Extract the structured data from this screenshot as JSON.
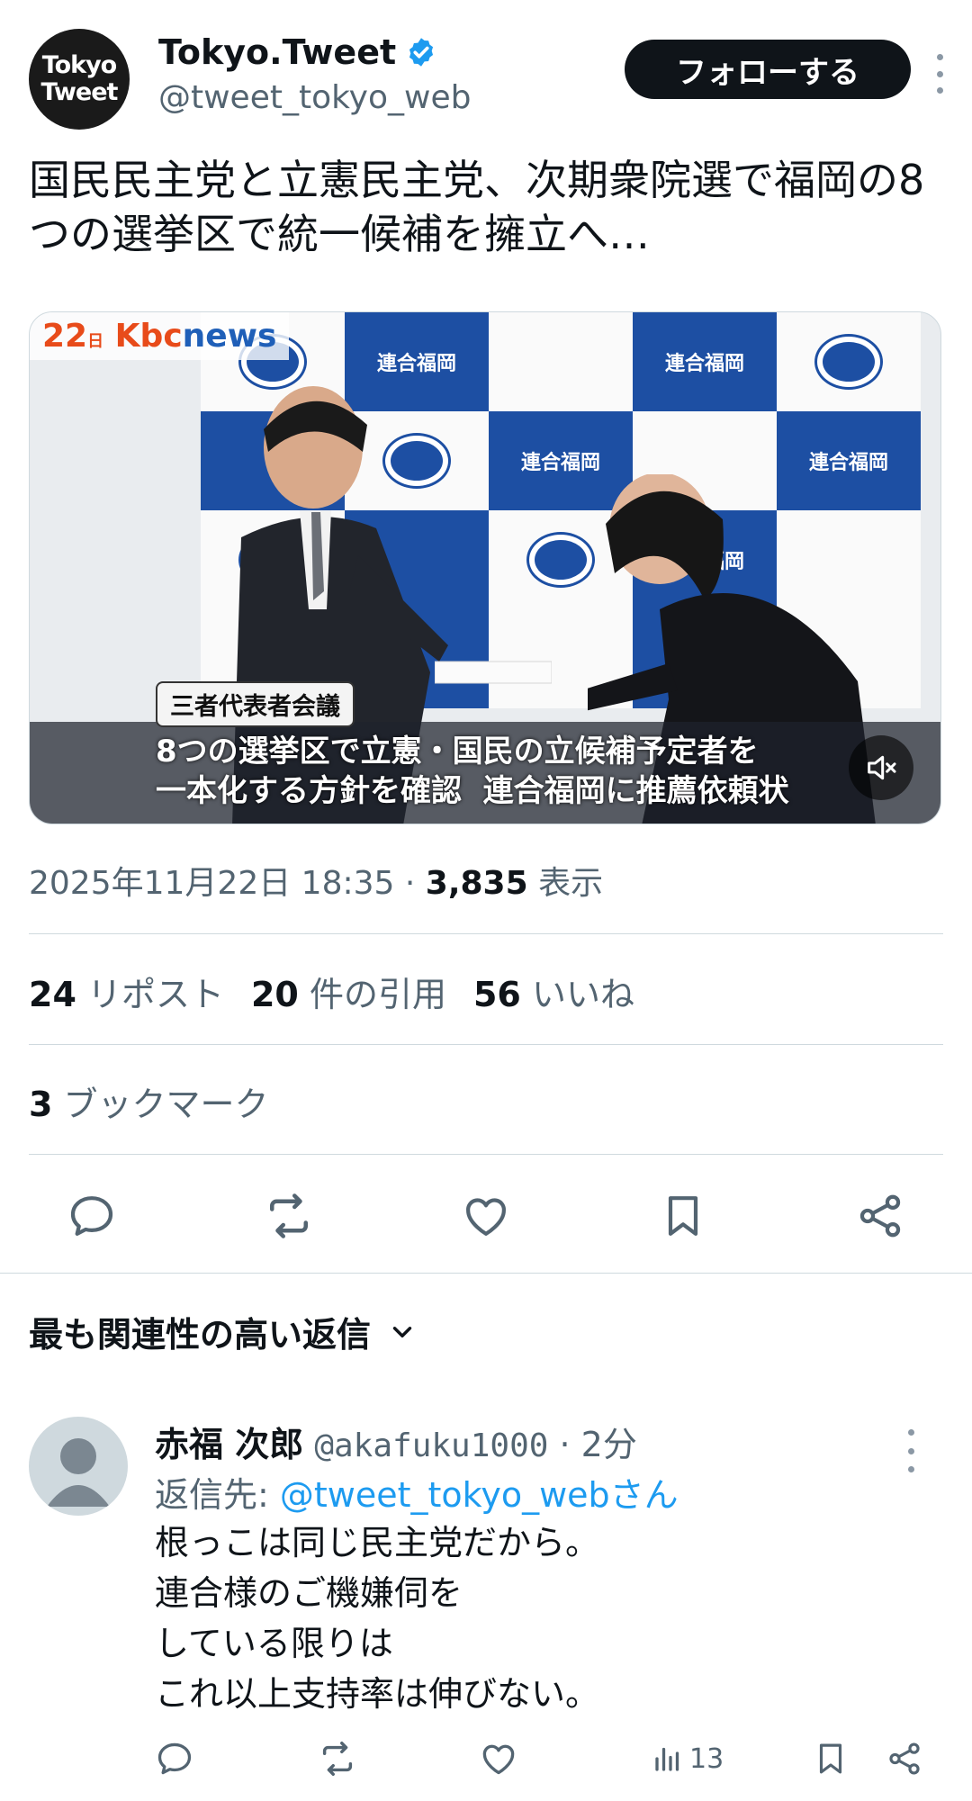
{
  "author": {
    "logo_line1": "Tokyo",
    "logo_line2": "Tweet",
    "name": "Tokyo.Tweet",
    "handle": "@tweet_tokyo_web",
    "follow_label": "フォローする"
  },
  "tweet": {
    "text": "国民民主党と立憲民主党、次期衆院選で福岡の8つの選挙区で統一候補を擁立へ…"
  },
  "media": {
    "kbc_num": "22",
    "kbc_small": "日",
    "kbc_brand1": "Kbc",
    "kbc_brand2": "news",
    "banner_text": "連合福岡",
    "caption_tag": "三者代表者会議",
    "caption_text": "8つの選挙区で立憲・国民の立候補予定者を\n一本化する方針を確認  連合福岡に推薦依頼状"
  },
  "meta": {
    "datetime": "2025年11月22日 18:35 · ",
    "views_count": "3,835",
    "views_label": " 表示"
  },
  "stats": {
    "reposts_count": "24",
    "reposts_label": " リポスト",
    "quotes_count": "20",
    "quotes_label": " 件の引用",
    "likes_count": "56",
    "likes_label": " いいね",
    "bookmarks_count": "3",
    "bookmarks_label": " ブックマーク"
  },
  "actions": [
    "reply-icon",
    "repost-icon",
    "like-icon",
    "bookmark-icon",
    "share-icon"
  ],
  "replies_sort": {
    "label": "最も関連性の高い返信"
  },
  "reply": {
    "name": "赤福 次郎",
    "handle": "@akafuku1000",
    "time": " · 2分",
    "reply_to_prefix": "返信先: ",
    "reply_to_handle": "@tweet_tokyo_webさん",
    "body": "根っこは同じ民主党だから。\n連合様のご機嫌伺を\nしている限りは\nこれ以上支持率は伸びない。",
    "views": "13"
  },
  "colors": {
    "accent": "#1d9bf0",
    "text_primary": "#0f1419",
    "text_secondary": "#536471",
    "divider": "#cfd9de"
  }
}
